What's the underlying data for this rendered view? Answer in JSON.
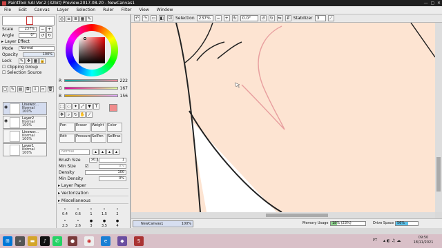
{
  "title": "PaintTool SAI Ver.2 (32bit) Preview.2017.08.20 - NewCanvas1",
  "menu": [
    "File",
    "Edit",
    "Canvas",
    "Layer",
    "Selection",
    "Ruler",
    "Filter",
    "View",
    "Window"
  ],
  "toolbar": {
    "selection": "Selection",
    "zoom": "237%",
    "angle": "0.0°",
    "stabilizer_label": "Stabilizer",
    "stabilizer_value": "3"
  },
  "left": {
    "scale_label": "Scale",
    "scale_value": "237%",
    "angle_label": "Angle",
    "angle_value": "0°",
    "layer_effect": "Layer Effect",
    "mode_label": "Mode",
    "mode_value": "Normal",
    "opacity_label": "Opacity",
    "opacity_value": "100%",
    "lock_label": "Lock",
    "clipping": "Clipping Group",
    "selection_source": "Selection Source",
    "layers": [
      {
        "name": "Linewor...",
        "mode": "Normal",
        "opacity": "100%"
      },
      {
        "name": "Layer2",
        "mode": "Normal",
        "opacity": "100%"
      },
      {
        "name": "Linewor...",
        "mode": "Normal",
        "opacity": "100%"
      },
      {
        "name": "Layer1",
        "mode": "Normal",
        "opacity": "100%"
      }
    ]
  },
  "colors": {
    "r_label": "R",
    "r": "222",
    "g_label": "G",
    "g": "167",
    "b_label": "B",
    "b": "156",
    "current": "#de8b9c"
  },
  "tools": {
    "row1": [
      "Pen",
      "Eraser",
      "Weight",
      "Color"
    ],
    "row2": [
      "Edit",
      "Pressure",
      "SelPen",
      "SelEras"
    ],
    "mode": "Normal"
  },
  "brush": {
    "size_label": "Brush Size",
    "size_mult": "x0.1",
    "size_value": "1",
    "minsize_label": "Min Size",
    "minsize_value": "0%",
    "density_label": "Density",
    "density_value": "100",
    "mindensity_label": "Min Density",
    "mindensity_value": "0%",
    "sections": [
      "Layer Paper",
      "Vectorization",
      "Miscellaneous"
    ],
    "sizes_row1": [
      "0.4",
      "0.6",
      "1",
      "1.5",
      "2"
    ],
    "sizes_row2": [
      "2.3",
      "2.6",
      "3",
      "3.5",
      "4"
    ]
  },
  "nav": {
    "canvas_name": "NewCanvas1",
    "canvas_zoom": "100%",
    "memory_label": "Memory Usage",
    "memory_value": "18% (23%)",
    "drive_label": "Drive Space",
    "drive_value": "56%"
  },
  "taskbar": {
    "time": "09:50",
    "date": "18/11/2021",
    "lang": "PT"
  },
  "accent": "#1a3f8f"
}
